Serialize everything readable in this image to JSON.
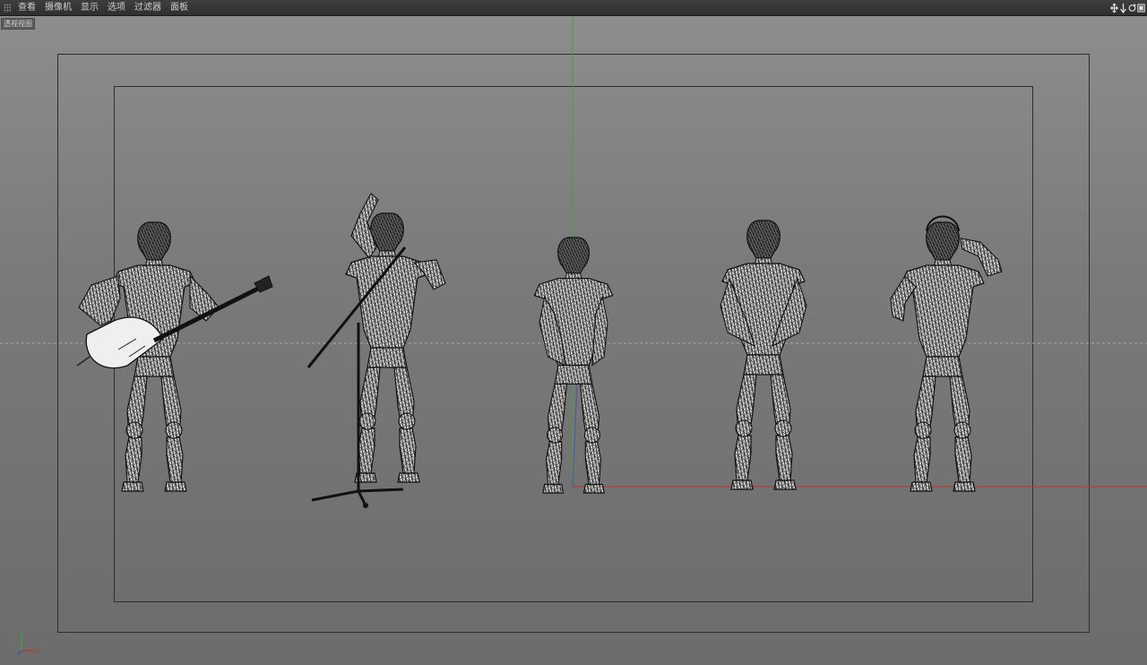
{
  "menu": {
    "items": [
      "查看",
      "摄像机",
      "显示",
      "选项",
      "过滤器",
      "面板"
    ]
  },
  "nav_icons": [
    "move-view-icon",
    "dolly-view-icon",
    "rotate-view-icon",
    "toggle-view-icon"
  ],
  "viewport": {
    "label": "透视视图"
  },
  "axis": {
    "y_label": "Y",
    "x_label": "X"
  },
  "colors": {
    "menubar": "#353535",
    "viewport_top": "#8d8d8d",
    "viewport_bottom": "#6c6c6c",
    "axis_x": "#c03030",
    "axis_y": "#3aa83a",
    "axis_z": "#4040c8",
    "mesh_fill": "#d9d9d9",
    "mesh_wire": "#151515"
  },
  "scene": {
    "figures": [
      {
        "name": "guitarist"
      },
      {
        "name": "singer-with-mic-stand"
      },
      {
        "name": "hip-pose-figure"
      },
      {
        "name": "standing-figure"
      },
      {
        "name": "headphone-figure"
      }
    ]
  }
}
